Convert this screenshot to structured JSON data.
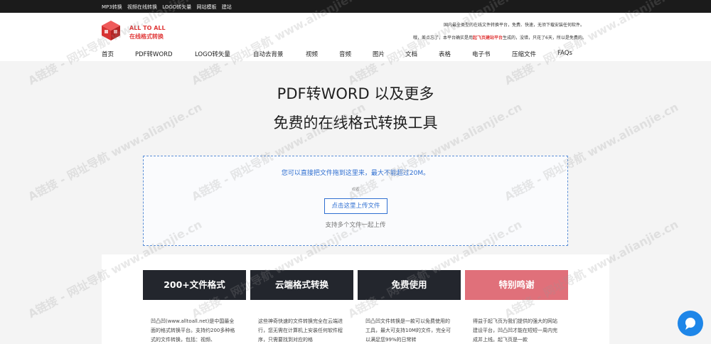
{
  "topbar": {
    "links": [
      "MP3转换",
      "视频在线转换",
      "LOGO转矢量",
      "网站模板",
      "建站"
    ]
  },
  "logo": {
    "line1": "ALL TO ALL",
    "line2": "在线格式转换",
    "icon": "cube-logo-icon",
    "color": "#e03a3a"
  },
  "intro": {
    "line1": "国内最全类型的在线文件转换平台，免费、快速，无须下载安装任何软件。",
    "line2_prefix": "哦，差点忘了，本平台确实是用",
    "line2_highlight": "起飞页建站平台",
    "line2_suffix": "生成的，没错，只花了6天，所以是免费的。"
  },
  "nav": [
    "首页",
    "PDF转WORD",
    "LOGO转矢量",
    "自动去背景",
    "视频",
    "音频",
    "图片",
    "文档",
    "表格",
    "电子书",
    "压缩文件",
    "FAQs"
  ],
  "hero": {
    "title1": "PDF转WORD 以及更多",
    "title2": "免费的在线格式转换工具"
  },
  "upload": {
    "hint": "您可以直接把文件拖到这里来，最大不能超过20M。",
    "or": "或者",
    "button": "点击这里上传文件",
    "sub": "支持多个文件一起上传"
  },
  "features": [
    {
      "title": "200+文件格式",
      "text": "凹凸凹(www.alltoall.net)是中国最全面的格式转换平台。支持约200多种格式的文件转换，包括：视频、"
    },
    {
      "title": "云端格式转换",
      "text": "这些神奇快速的文件转换完全在云端进行，您无需在计算机上安装任何软件程序，只需要找到对应的格"
    },
    {
      "title": "免费使用",
      "text": "凹凸凹文件转换是一款可以免费使用的工具，最大可支持10M的文件，完全可以满足您99%的日常转"
    },
    {
      "title": "特别鸣谢",
      "text": "得益于起飞页为我们提供的强大的网站建设平台，凹凸凹才能在短短一周内完成并上线。起飞页是一款"
    }
  ],
  "colors": {
    "topbar": "#1b1b1b",
    "accent": "#2f6fd1",
    "card_dark": "#23262d",
    "card_pink": "#e0707a",
    "chat": "#1e86e8"
  },
  "chat": {
    "icon": "chat-bubble-icon"
  },
  "watermark": "A链接 - 网址导航 www.alianjie.cn"
}
